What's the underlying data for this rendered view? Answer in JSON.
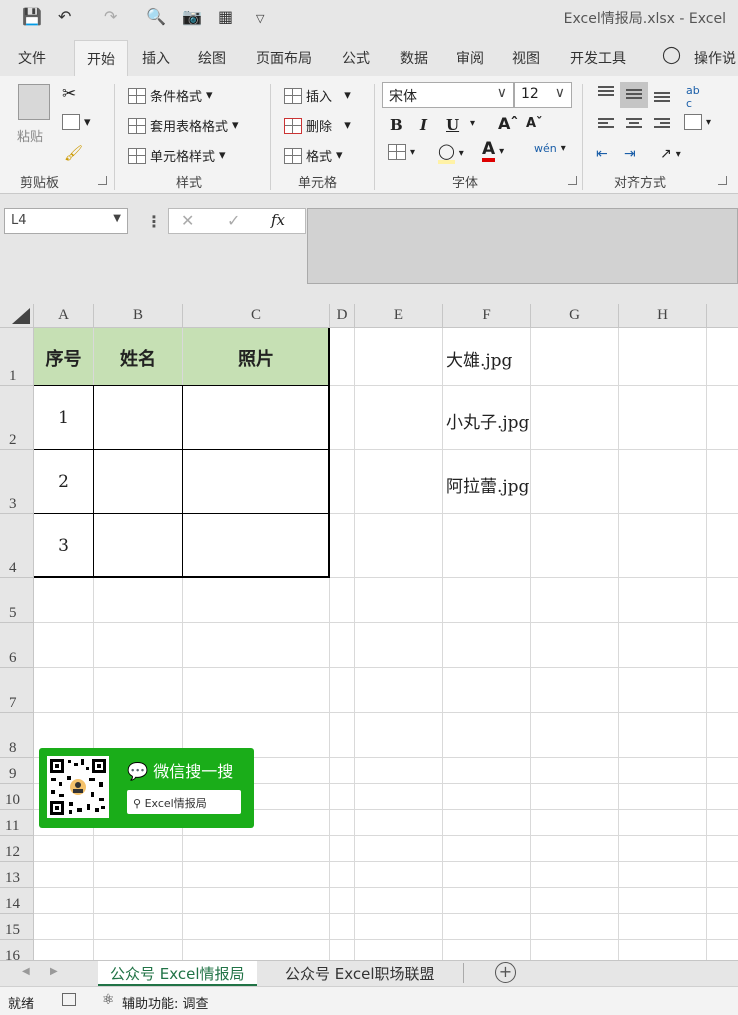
{
  "window": {
    "title": "Excel情报局.xlsx  -  Excel"
  },
  "quick_access": {
    "icons": [
      "save-icon",
      "undo-icon",
      "redo-icon",
      "print-preview-icon",
      "camera-icon",
      "table-icon",
      "customize-icon"
    ]
  },
  "tabs": [
    "文件",
    "开始",
    "插入",
    "绘图",
    "页面布局",
    "公式",
    "数据",
    "审阅",
    "视图",
    "开发工具",
    "操作说"
  ],
  "active_tab": "开始",
  "ribbon": {
    "clipboard": {
      "paste": "粘贴",
      "label": "剪贴板"
    },
    "styles": {
      "cond_format": "条件格式",
      "table_format": "套用表格格式",
      "cell_styles": "单元格样式",
      "label": "样式"
    },
    "cells": {
      "insert": "插入",
      "delete": "删除",
      "format": "格式",
      "label": "单元格"
    },
    "font": {
      "name": "宋体",
      "size": "12",
      "bold": "B",
      "italic": "I",
      "underline": "U",
      "label": "字体"
    },
    "alignment": {
      "label": "对齐方式"
    }
  },
  "formula_bar": {
    "name_box": "L4",
    "cancel": "✕",
    "enter": "✓",
    "fx": "fx"
  },
  "columns": [
    "A",
    "B",
    "C",
    "D",
    "E",
    "F",
    "G",
    "H"
  ],
  "rows": [
    "1",
    "2",
    "3",
    "4",
    "5",
    "6",
    "7",
    "8",
    "9",
    "10",
    "11",
    "12",
    "13",
    "14",
    "15",
    "16"
  ],
  "table": {
    "headers": [
      "序号",
      "姓名",
      "照片"
    ],
    "rows": [
      [
        "1",
        "",
        ""
      ],
      [
        "2",
        "",
        ""
      ],
      [
        "3",
        "",
        ""
      ]
    ]
  },
  "filenames": [
    "大雄.jpg",
    "小丸子.jpg",
    "阿拉蕾.jpg"
  ],
  "wechat": {
    "title": "微信搜一搜",
    "search": "Excel情报局"
  },
  "sheet_tabs": [
    "公众号 Excel情报局",
    "公众号 Excel职场联盟"
  ],
  "status": {
    "ready": "就绪",
    "accessibility": "辅助功能: 调查"
  },
  "colors": {
    "header_fill": "#c6e0b4",
    "accent_green": "#217346",
    "wechat_green": "#1aad19"
  }
}
